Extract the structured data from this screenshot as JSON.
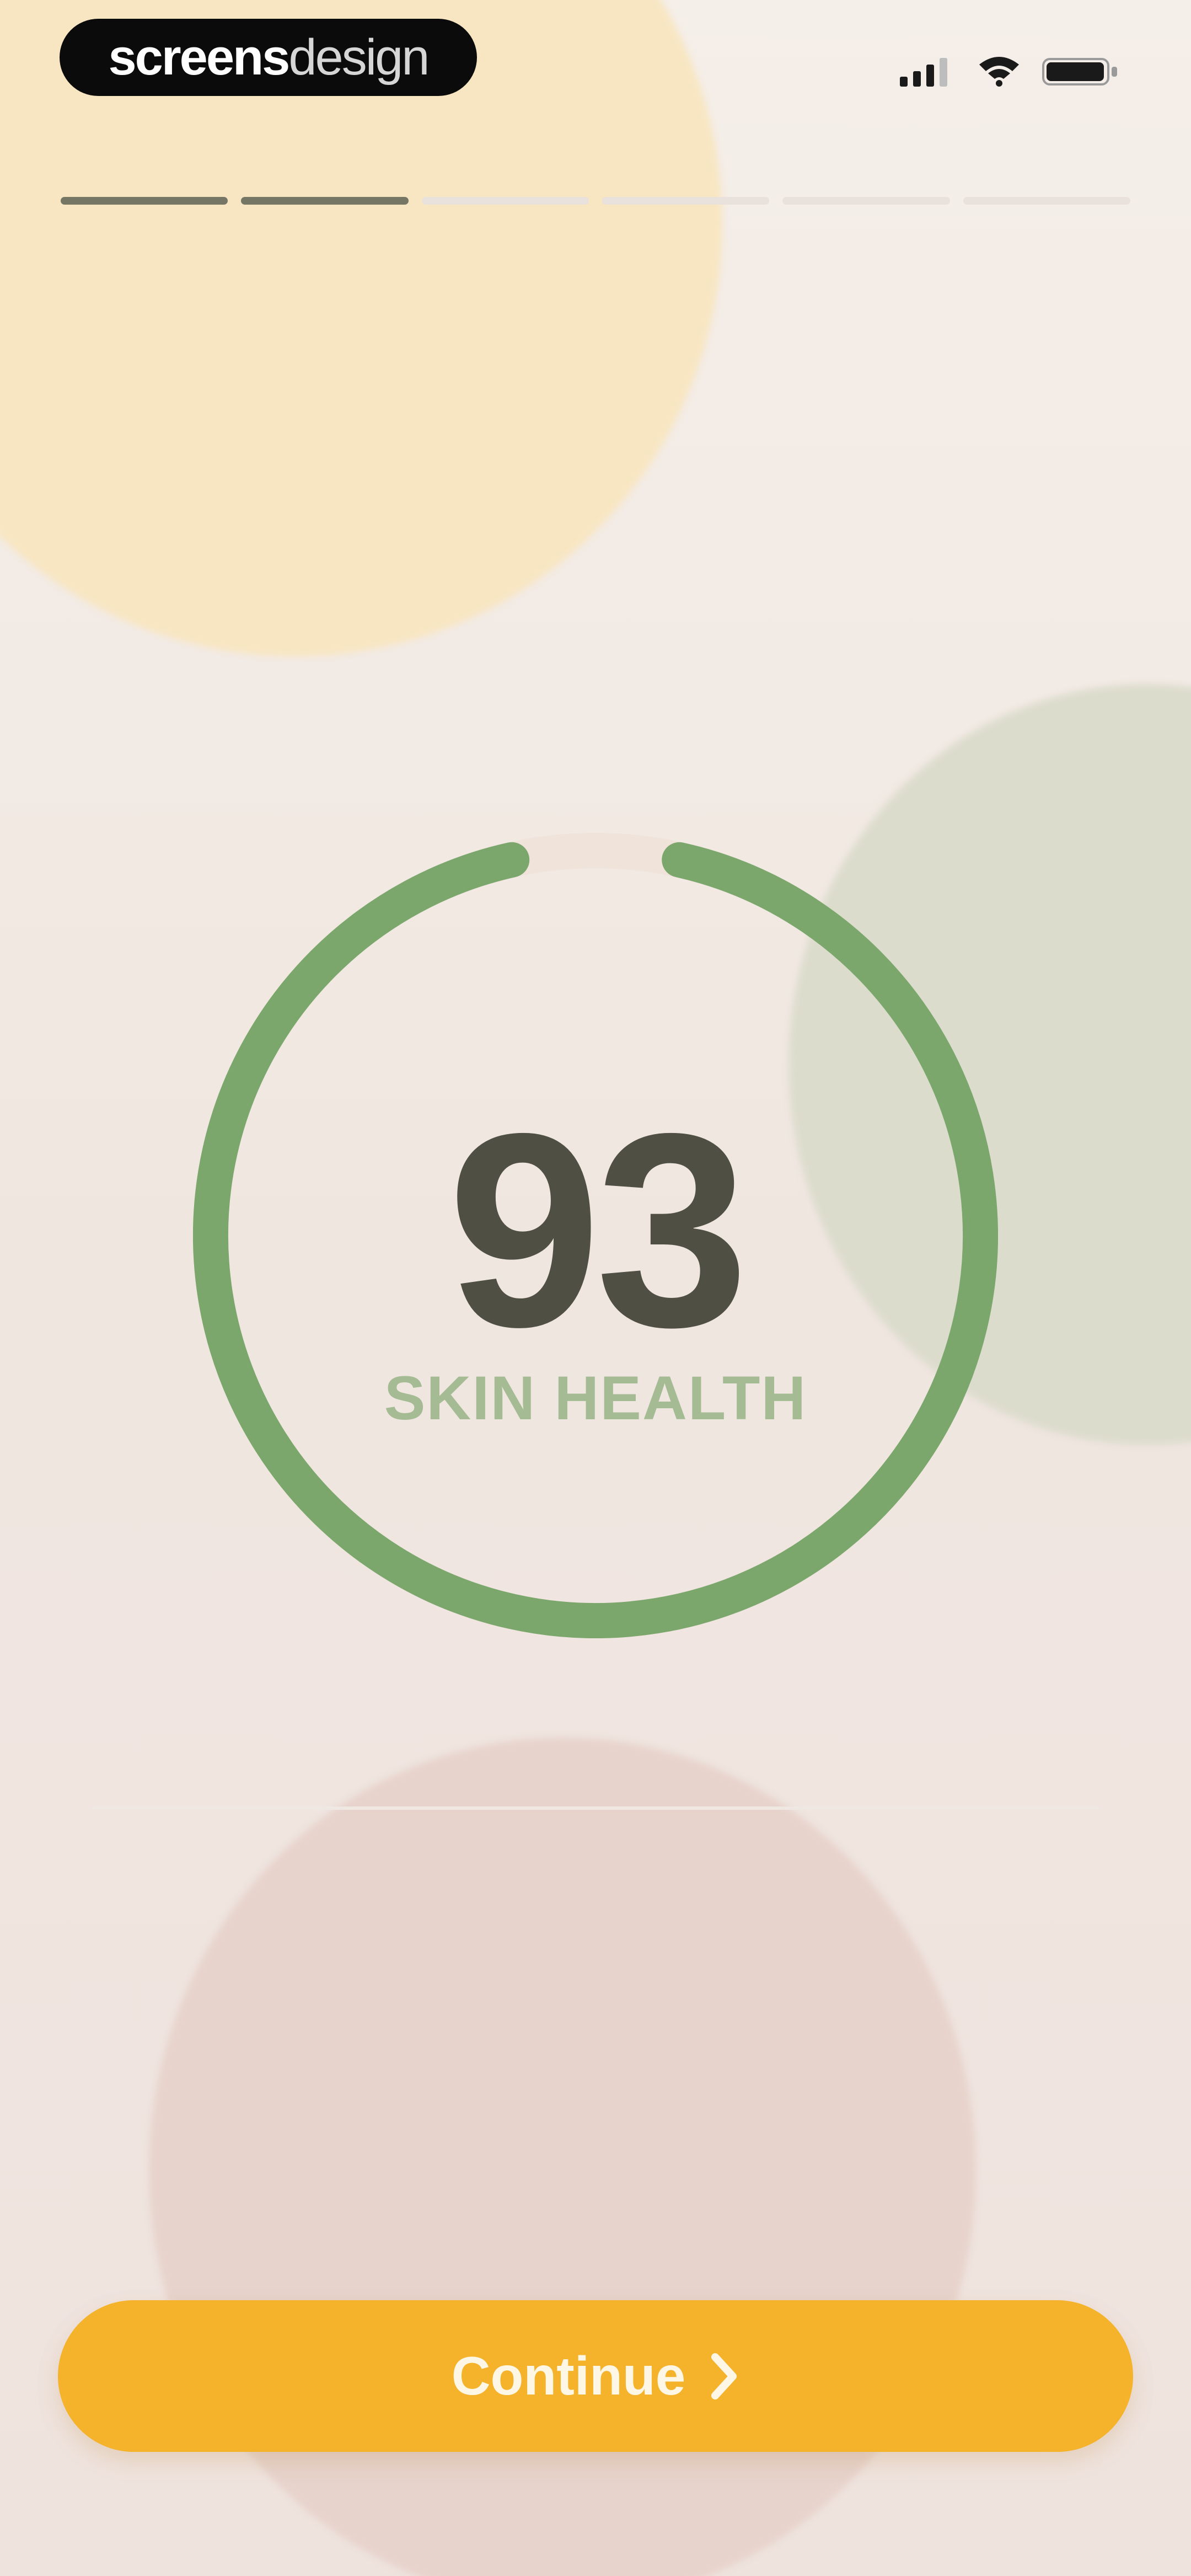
{
  "status_bar": {
    "brand": {
      "bold": "screens",
      "light": "design"
    },
    "icons": [
      "signal-icon",
      "wifi-icon",
      "battery-icon"
    ]
  },
  "progress": {
    "total_steps": 6,
    "completed_steps": 2
  },
  "score": {
    "value": "93",
    "label": "SKIN HEALTH",
    "fraction": 0.93
  },
  "continue_button": {
    "label": "Continue",
    "icon": "chevron-right-icon"
  },
  "colors": {
    "ring": "#7ba76d",
    "ring_track": "#efe3da",
    "button": "#f5b22b",
    "score_text": "#4f4f44",
    "label_text": "#a4bb93",
    "progress_done": "#767665",
    "progress_todo": "#e9e1db"
  }
}
